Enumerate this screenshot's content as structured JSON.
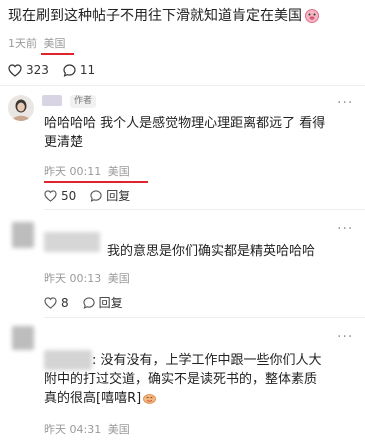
{
  "post": {
    "text": "现在刷到这种帖子不用往下滑就知道肯定在美国",
    "time": "1天前",
    "location": "美国",
    "likes": "323",
    "comments": "11"
  },
  "comments": [
    {
      "author_tag": "作者",
      "text_lines": [
        "哈哈哈哈 我个人是感觉物理心理距离都远了 看得",
        "更清楚"
      ],
      "time": "昨天 00:11",
      "location": "美国",
      "likes": "50",
      "reply_label": "回复"
    },
    {
      "text_lines": [
        "我的意思是你们确实都是精英哈哈哈"
      ],
      "time": "昨天 00:13",
      "location": "美国",
      "likes": "8",
      "reply_label": "回复"
    },
    {
      "text_lines": [
        ": 没有没有，上学工作中跟一些你们人大",
        "附中的打过交道，确实不是读死书的，整体素质",
        "真的很高[嘻嘻R]"
      ],
      "time": "昨天 04:31",
      "location": "美国"
    }
  ],
  "colors": {
    "highlight_underline": "#e0242c",
    "meta_gray": "#9a9a9a"
  },
  "icons": [
    "heart-outline-icon",
    "comment-bubble-icon",
    "more-dots-icon",
    "emoji-face-icon"
  ]
}
